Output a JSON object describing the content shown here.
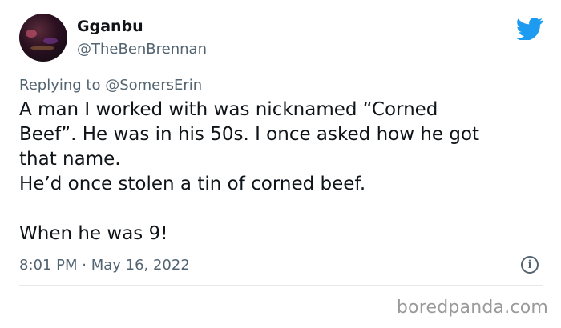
{
  "tweet": {
    "author": {
      "display_name": "Gganbu",
      "handle": "@TheBenBrennan"
    },
    "replying_to_prefix": "Replying to ",
    "replying_to_handle": "@SomersErin",
    "body": {
      "line1": "A man I worked with was nicknamed “Corned",
      "line2": "Beef”. He was in his 50s. I once asked how he got",
      "line3": "that name.",
      "line4": "He’d once stolen a tin of corned beef.",
      "line5": "When he was 9!"
    },
    "timestamp": "8:01 PM · May 16, 2022",
    "info_icon_glyph": "i"
  },
  "icons": {
    "brand": "twitter-bird-icon",
    "info": "info-icon"
  },
  "colors": {
    "twitter_blue": "#1d9bf0",
    "secondary_text": "#536471",
    "primary_text": "#0f1419"
  },
  "watermark": "boredpanda.com"
}
